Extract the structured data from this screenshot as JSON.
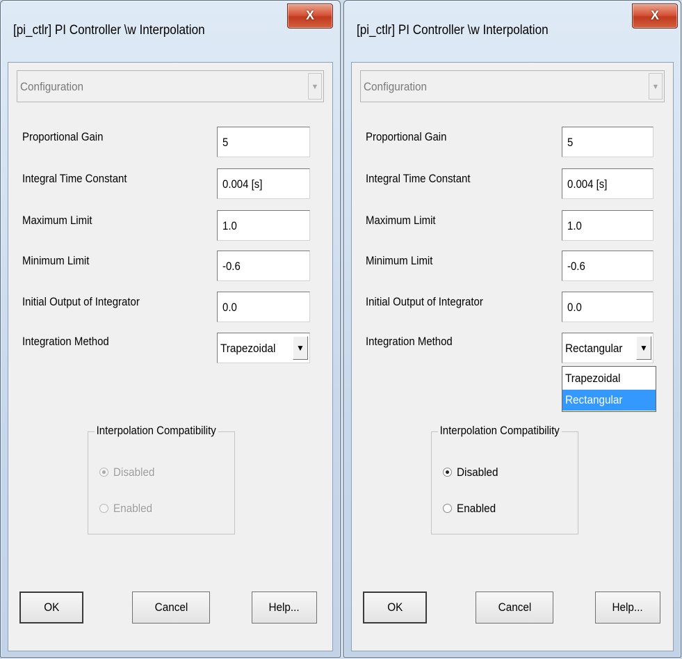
{
  "dialogs": [
    {
      "title": "[pi_ctlr] PI Controller \\w Interpolation",
      "close_label": "X",
      "configuration": "Configuration",
      "fields": [
        {
          "label": "Proportional Gain",
          "value": "5"
        },
        {
          "label": "Integral Time Constant",
          "value": "0.004 [s]"
        },
        {
          "label": "Maximum Limit",
          "value": "1.0"
        },
        {
          "label": "Minimum Limit",
          "value": "-0.6"
        },
        {
          "label": "Initial Output of Integrator",
          "value": "0.0"
        }
      ],
      "integration_method": {
        "label": "Integration Method",
        "value": "Trapezoidal"
      },
      "group": {
        "title": "Interpolation Compatibility",
        "state": "disabled",
        "options": [
          {
            "label": "Disabled",
            "checked": true
          },
          {
            "label": "Enabled",
            "checked": false
          }
        ]
      },
      "buttons": {
        "ok": "OK",
        "cancel": "Cancel",
        "help": "Help..."
      }
    },
    {
      "title": "[pi_ctlr] PI Controller \\w Interpolation",
      "close_label": "X",
      "configuration": "Configuration",
      "fields": [
        {
          "label": "Proportional Gain",
          "value": "5"
        },
        {
          "label": "Integral Time Constant",
          "value": "0.004 [s]"
        },
        {
          "label": "Maximum Limit",
          "value": "1.0"
        },
        {
          "label": "Minimum Limit",
          "value": "-0.6"
        },
        {
          "label": "Initial Output of Integrator",
          "value": "0.0"
        }
      ],
      "integration_method": {
        "label": "Integration Method",
        "value": "Rectangular",
        "dropdown_open": true,
        "options": [
          "Trapezoidal",
          "Rectangular"
        ],
        "highlighted": "Rectangular"
      },
      "group": {
        "title": "Interpolation Compatibility",
        "state": "enabled",
        "options": [
          {
            "label": "Disabled",
            "checked": true
          },
          {
            "label": "Enabled",
            "checked": false
          }
        ]
      },
      "buttons": {
        "ok": "OK",
        "cancel": "Cancel",
        "help": "Help..."
      }
    }
  ],
  "colors": {
    "selection": "#3399ff",
    "close_button": "#c8432a"
  }
}
